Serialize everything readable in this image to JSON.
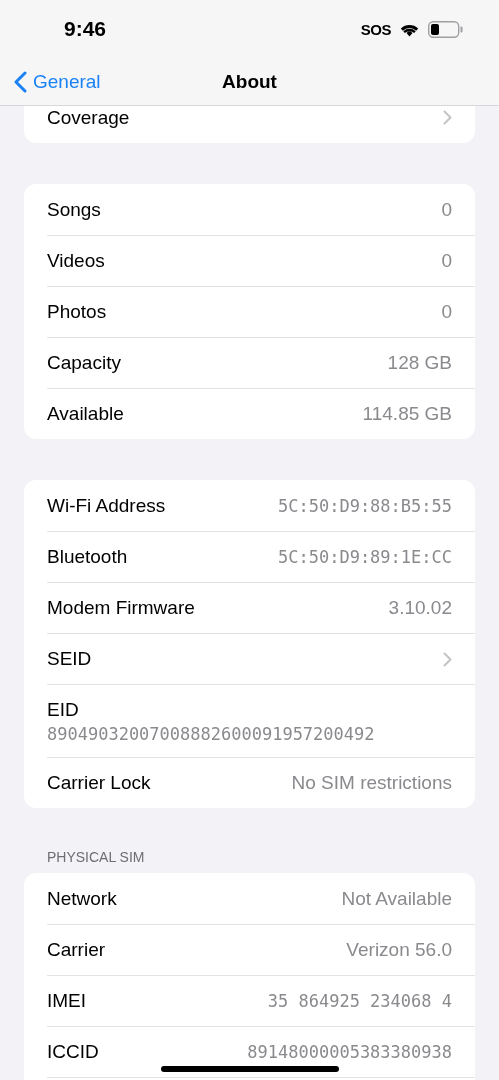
{
  "status_bar": {
    "time": "9:46",
    "sos": "SOS"
  },
  "nav": {
    "back": "General",
    "title": "About"
  },
  "sections": [
    {
      "rows": [
        {
          "kind": "link",
          "label": "Coverage"
        }
      ]
    },
    {
      "rows": [
        {
          "kind": "value",
          "label": "Songs",
          "value": "0"
        },
        {
          "kind": "value",
          "label": "Videos",
          "value": "0"
        },
        {
          "kind": "value",
          "label": "Photos",
          "value": "0"
        },
        {
          "kind": "value",
          "label": "Capacity",
          "value": "128 GB"
        },
        {
          "kind": "value",
          "label": "Available",
          "value": "114.85 GB"
        }
      ]
    },
    {
      "rows": [
        {
          "kind": "value",
          "label": "Wi-Fi Address",
          "value": "5C:50:D9:88:B5:55",
          "mono": true
        },
        {
          "kind": "value",
          "label": "Bluetooth",
          "value": "5C:50:D9:89:1E:CC",
          "mono": true
        },
        {
          "kind": "value",
          "label": "Modem Firmware",
          "value": "3.10.02"
        },
        {
          "kind": "link",
          "label": "SEID"
        },
        {
          "kind": "stacked",
          "label": "EID",
          "value": "89049032007008882600091957200492",
          "mono": true
        },
        {
          "kind": "value",
          "label": "Carrier Lock",
          "value": "No SIM restrictions"
        }
      ]
    },
    {
      "header": "PHYSICAL SIM",
      "rows": [
        {
          "kind": "value",
          "label": "Network",
          "value": "Not Available"
        },
        {
          "kind": "value",
          "label": "Carrier",
          "value": "Verizon 56.0"
        },
        {
          "kind": "value",
          "label": "IMEI",
          "value": "35 864925 234068 4",
          "mono": true
        },
        {
          "kind": "value",
          "label": "ICCID",
          "value": "89148000005383380938",
          "mono": true
        },
        {
          "kind": "blank"
        }
      ]
    }
  ]
}
